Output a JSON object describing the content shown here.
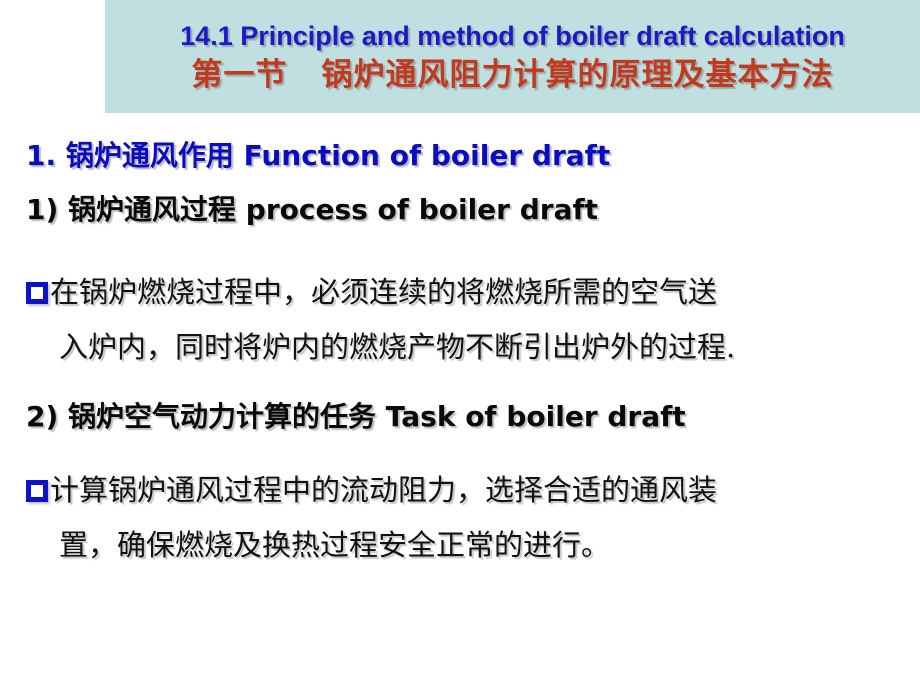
{
  "slide": {
    "title": {
      "english": "14.1 Principle and method of boiler draft calculation",
      "chinese_prefix": "第一节",
      "chinese_main": "锅炉通风阻力计算的原理及基本方法",
      "banner_color": "#bfdfe0",
      "english_color": "#1a1ac8",
      "chinese_color": "#c23a1e"
    },
    "body": {
      "heading_1": "1. 锅炉通风作用 Function of boiler draft",
      "heading_1_color": "#0b0bc4",
      "heading_2": "1) 锅炉通风过程 process of boiler draft",
      "heading_3": "2) 锅炉空气动力计算的任务 Task of boiler draft",
      "heading_color": "#0a0a0a",
      "bullets": [
        {
          "marker": "hollow-square-bullet",
          "marker_color": "#1111cc",
          "lines": [
            "在锅炉燃烧过程中，必须连续的将燃烧所需的空气送",
            "入炉内，同时将炉内的燃烧产物不断引出炉外的过程."
          ]
        },
        {
          "marker": "hollow-square-bullet",
          "marker_color": "#1111cc",
          "lines": [
            "计算锅炉通风过程中的流动阻力，选择合适的通风装",
            "置，确保燃烧及换热过程安全正常的进行。"
          ]
        }
      ]
    }
  }
}
